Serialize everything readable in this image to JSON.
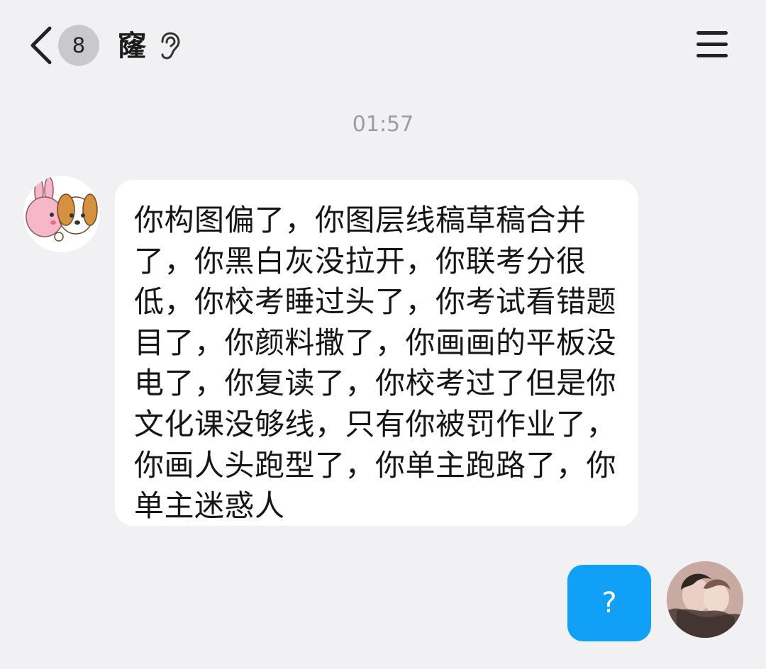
{
  "header": {
    "unread_count": "8",
    "title": "窿",
    "back_icon": "chevron-left-icon",
    "voice_icon": "ear-icon",
    "menu_icon": "hamburger-menu-icon"
  },
  "conversation": {
    "timestamp": "01:57",
    "messages": [
      {
        "side": "incoming",
        "avatar": "cartoon-rabbit-dog-avatar",
        "text": "你构图偏了，你图层线稿草稿合并了，你黑白灰没拉开，你联考分很低，你校考睡过头了，你考试看错题目了，你颜料撒了，你画画的平板没电了，你复读了，你校考过了但是你文化课没够线，只有你被罚作业了，你画人头跑型了，你单主跑路了，你单主迷惑人"
      },
      {
        "side": "outgoing",
        "avatar": "illustrated-character-avatar",
        "text": "?"
      }
    ]
  },
  "colors": {
    "background": "#f1f1f3",
    "incoming_bubble": "#ffffff",
    "outgoing_bubble": "#11a0f8",
    "timestamp": "#9c9ca1",
    "badge": "#c9c9cc"
  }
}
